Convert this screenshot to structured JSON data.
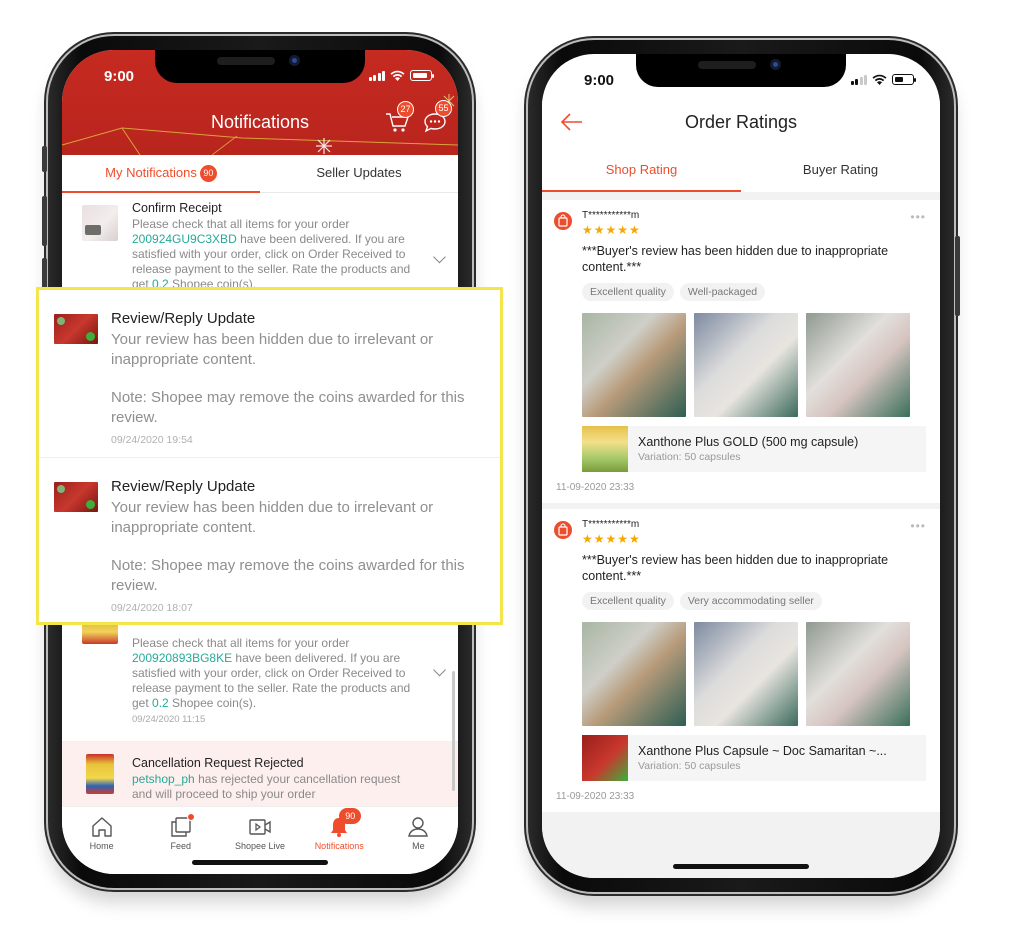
{
  "left_phone": {
    "status_time": "9:00",
    "header_title": "Notifications",
    "cart_badge": "27",
    "chat_badge": "55",
    "tabs": [
      {
        "label": "My Notifications",
        "badge": "90",
        "active": true
      },
      {
        "label": "Seller Updates",
        "active": false
      }
    ],
    "notifications": [
      {
        "title": "Confirm Receipt",
        "body_pre": "Please check that all items for your order ",
        "order_id": "200924GU9C3XBD",
        "body_post": " have been delivered. If you are satisfied with your order, click on Order Received to release payment to the seller. Rate the products and get ",
        "coins": "0.2",
        "body_end": " Shopee coin(s)."
      },
      {
        "title": "",
        "body_pre": "Please check that all items for your order ",
        "order_id": "200920893BG8KE",
        "body_post": " have been delivered. If you are satisfied with your order, click on Order Received to release payment to the seller. Rate the products and get ",
        "coins": "0.2",
        "body_end": " Shopee coin(s).",
        "time": "09/24/2020 11:15"
      },
      {
        "title": "Cancellation Request Rejected",
        "shop": "petshop_ph",
        "body": " has rejected your cancellation request and will proceed to ship your order"
      }
    ],
    "highlighted": [
      {
        "title": "Review/Reply Update",
        "body": "Your review has been hidden due to irrelevant or inappropriate content.",
        "note": "Note: Shopee may remove the coins awarded for this review.",
        "time": "09/24/2020 19:54"
      },
      {
        "title": "Review/Reply Update",
        "body": "Your review has been hidden due to irrelevant or inappropriate content.",
        "note": "Note: Shopee may remove the coins awarded for this review.",
        "time": "09/24/2020 18:07"
      }
    ],
    "bottom_nav": [
      {
        "label": "Home",
        "icon": "home-icon"
      },
      {
        "label": "Feed",
        "icon": "feed-icon"
      },
      {
        "label": "Shopee Live",
        "icon": "live-video-icon"
      },
      {
        "label": "Notifications",
        "icon": "bell-icon",
        "badge": "90",
        "active": true
      },
      {
        "label": "Me",
        "icon": "user-icon"
      }
    ]
  },
  "right_phone": {
    "status_time": "9:00",
    "header_title": "Order Ratings",
    "tabs": [
      {
        "label": "Shop Rating",
        "active": true
      },
      {
        "label": "Buyer Rating",
        "active": false
      }
    ],
    "reviews": [
      {
        "reviewer": "T***********m",
        "rating": 5,
        "stars": "★★★★★",
        "text": "***Buyer's review has been hidden due to inappropriate content.***",
        "tags": [
          "Excellent quality",
          "Well-packaged"
        ],
        "product_name": "Xanthone Plus GOLD (500 mg capsule)",
        "variation": "Variation: 50 capsules",
        "date": "11-09-2020 23:33"
      },
      {
        "reviewer": "T***********m",
        "rating": 5,
        "stars": "★★★★★",
        "text": "***Buyer's review has been hidden due to inappropriate content.***",
        "tags": [
          "Excellent quality",
          "Very accommodating seller"
        ],
        "product_name": "Xanthone Plus Capsule ~ Doc Samaritan ~...",
        "variation": "Variation: 50 capsules",
        "date": "11-09-2020 23:33"
      }
    ],
    "more_label": "•••"
  },
  "colors": {
    "brand": "#ee4d2d",
    "header_red": "#c62a21",
    "teal_link": "#26aa99",
    "star": "#f6a700",
    "highlight_border": "#f4e64a"
  }
}
